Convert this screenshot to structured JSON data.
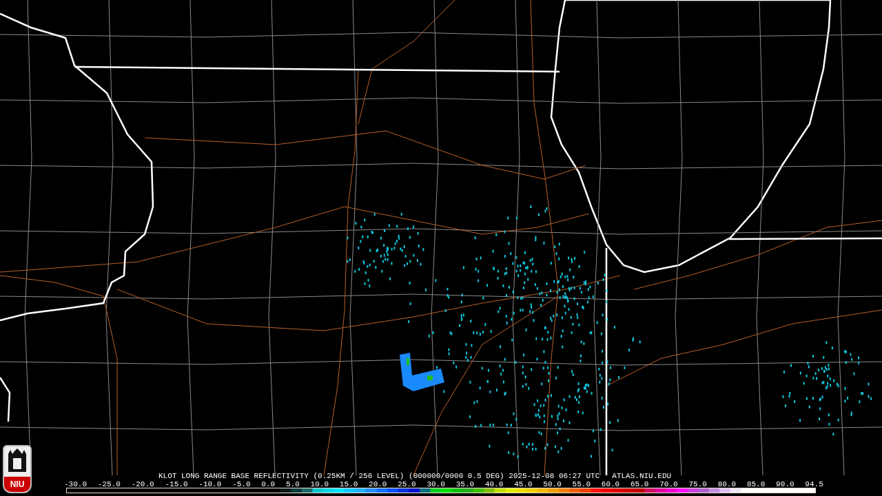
{
  "logo": {
    "text": "NIU"
  },
  "caption": {
    "product": "KLOT LONG RANGE BASE REFLECTIVITY (0.25KM / 256 LEVEL) (000000/0000 0.5 DEG) 2025-12-08 06:27 UTC",
    "site": "ATLAS.NIU.EDU"
  },
  "scale": {
    "labels": [
      "-30.0",
      "-25.0",
      "-20.0",
      "-15.0",
      "-10.0",
      "-5.0",
      "0.0",
      "5.0",
      "10.0",
      "15.0",
      "20.0",
      "25.0",
      "30.0",
      "35.0",
      "40.0",
      "45.0",
      "50.0",
      "55.0",
      "60.0",
      "65.0",
      "70.0",
      "75.0",
      "80.0",
      "85.0",
      "90.0",
      "94.5"
    ]
  }
}
